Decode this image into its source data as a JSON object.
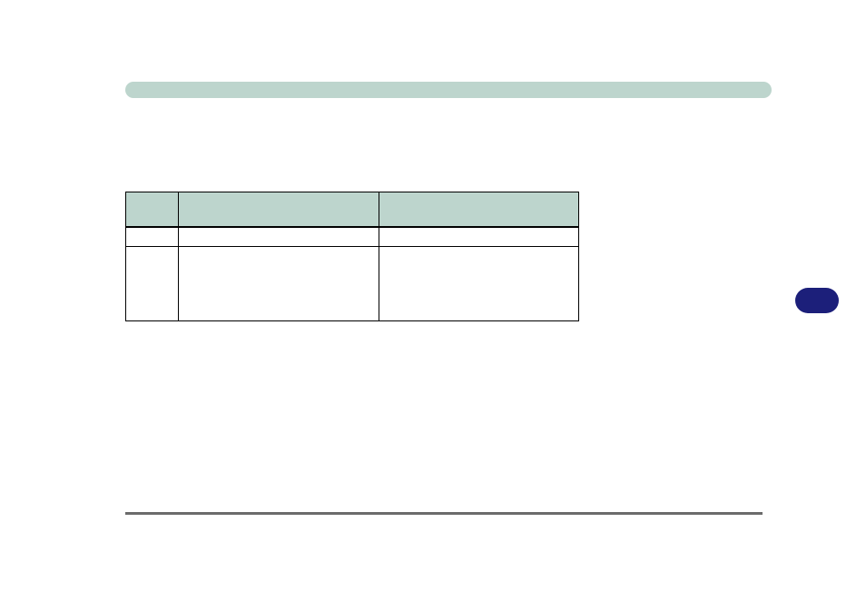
{
  "title_bar": {
    "text": ""
  },
  "table": {
    "headers": [
      "",
      "",
      ""
    ],
    "rows": [
      [
        "",
        "",
        ""
      ],
      [
        "",
        "",
        ""
      ]
    ]
  },
  "page_badge": {
    "label": ""
  },
  "footer": {
    "text": ""
  }
}
